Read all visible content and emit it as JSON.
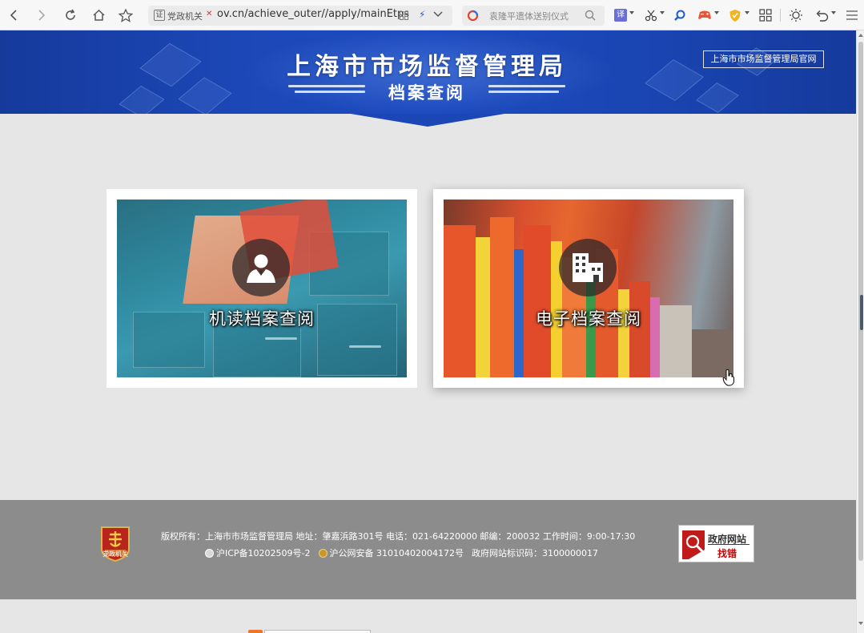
{
  "browser": {
    "address": {
      "site_label": "党政机关",
      "url_text": "ov.cn/achieve_outer//apply/mainEtps"
    },
    "search": {
      "placeholder": "袁隆平遗体送别仪式"
    },
    "extensions": {
      "translate_label": "译"
    }
  },
  "header": {
    "title": "上海市市场监督管理局",
    "subtitle": "档案查阅",
    "official_link": "上海市市场监督管理局官网"
  },
  "cards": [
    {
      "title": "机读档案查阅",
      "icon": "user-icon"
    },
    {
      "title": "电子档案查阅",
      "icon": "building-icon"
    }
  ],
  "footer": {
    "line1": "版权所有：上海市市场监督管理局 地址：肇嘉浜路301号 电话：021-64220000 邮编：200032 工作时间：9:00-17:30",
    "icp": "沪ICP备10202509号-2",
    "police": "沪公网安备 31010402004172号",
    "site_code": "政府网站标识码：3100000017",
    "emblem_text": "党政机关",
    "badge_top": "政府网站",
    "badge_bottom": "找错"
  },
  "colors": {
    "banner": "#1c48b8",
    "footer": "#8c8c8c",
    "page_bg": "#e6e6e6"
  }
}
